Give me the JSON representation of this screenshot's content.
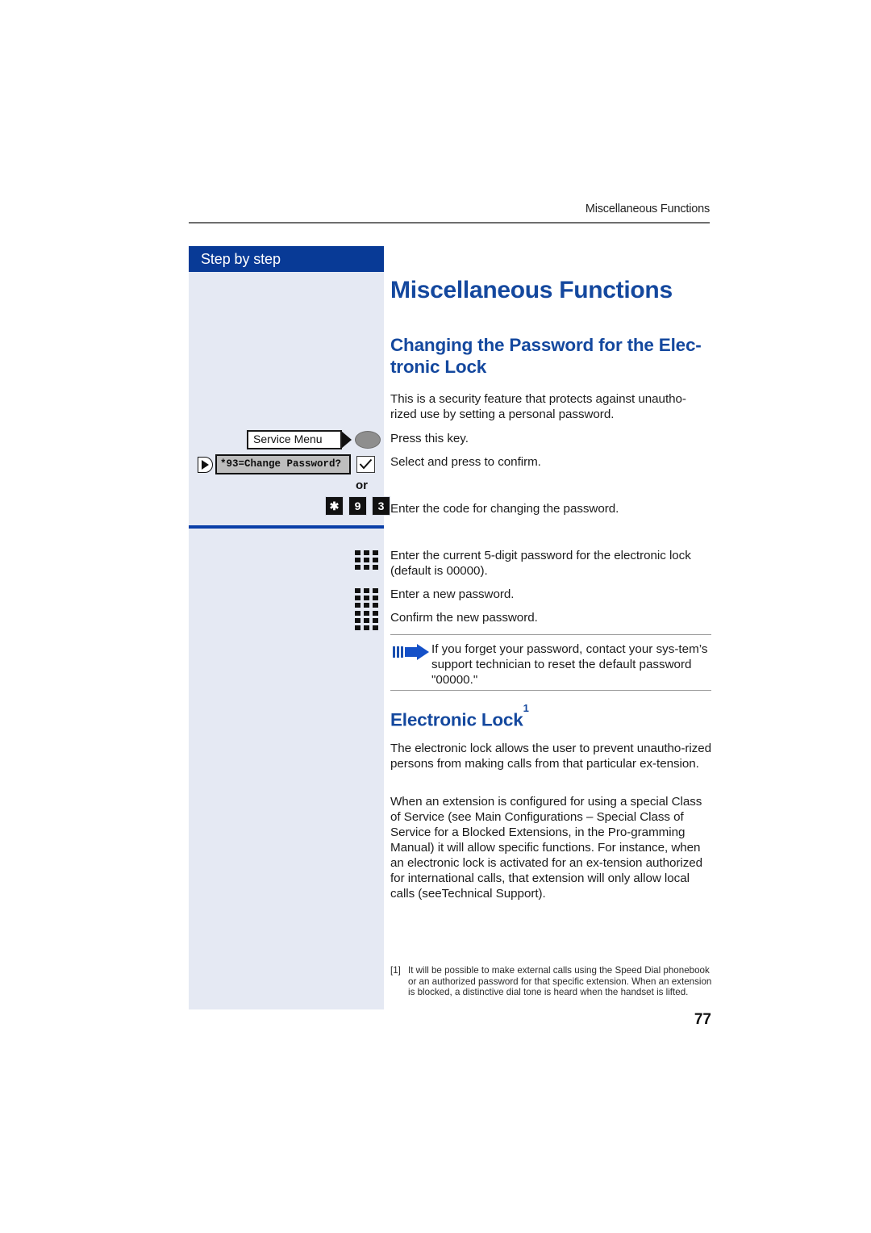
{
  "header": {
    "running_title": "Miscellaneous Functions"
  },
  "sidebar": {
    "title": "Step by step",
    "ui_elements": {
      "softkey_label": "Service Menu",
      "softkey_icon": "oval-key-icon",
      "display_line": "*93=Change Password?",
      "nav_icon": "right-arrow-key-icon",
      "confirm_icon": "checkmark-key-icon",
      "or_label": "or",
      "digit_keys": [
        "✱",
        "9",
        "3"
      ],
      "keypad_icon_name": "keypad-icon"
    }
  },
  "main": {
    "h1": "Miscellaneous Functions",
    "h2_password": "Changing the Password for the Elec-\ntronic Lock",
    "p_intro": "This is a security feature that protects against unautho-rized use by setting a personal password.",
    "p_press": "Press this key.",
    "p_select": "Select and press to confirm.",
    "p_code": "Enter the code for changing the password.",
    "p_current": "Enter the current 5-digit password for the electronic lock (default is 00000).",
    "p_newpw": "Enter a new password.",
    "p_confirm": "Confirm the new password.",
    "note": {
      "icon": "note-arrow-icon",
      "text": "If you forget your password, contact your sys-tem’s support technician to reset the default password \"00000.\""
    },
    "h2_lock": "Electronic Lock",
    "h2_lock_footnote_marker": "1",
    "p_lock1": "The electronic lock allows the user to prevent unautho-rized persons from making calls from that particular ex-tension.",
    "p_lock2": "When an extension is configured for using a special Class of Service (see Main Configurations – Special Class of Service for a Blocked Extensions, in the Pro-gramming Manual) it will allow specific functions. For instance, when an electronic lock is activated for an ex-tension authorized for international calls, that extension will only allow local calls (seeTechnical Support)."
  },
  "footnote": {
    "marker": "[1]",
    "text": "It will be possible to make external calls using the Speed Dial phonebook or an authorized password for that specific extension. When an extension is blocked, a distinctive dial tone is heard when the handset is lifted."
  },
  "page_number": "77",
  "colors": {
    "brand_blue": "#14489e",
    "sidebar_header": "#083a96",
    "sidebar_bg": "#e5e9f3",
    "divider_blue": "#0a3fa8"
  }
}
